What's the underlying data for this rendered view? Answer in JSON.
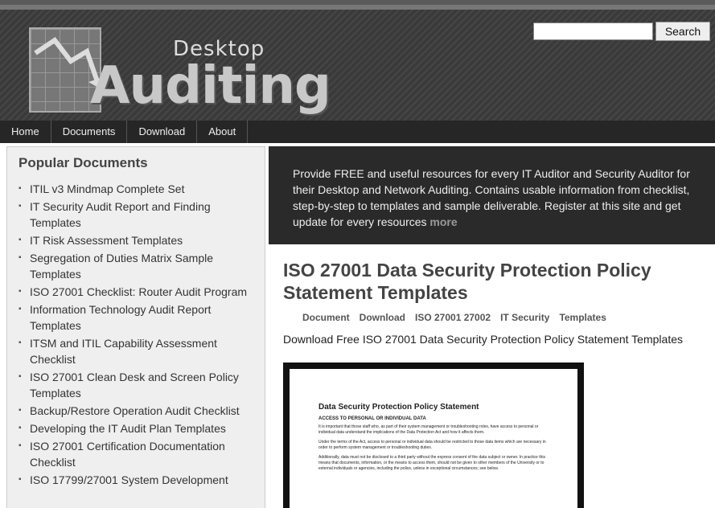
{
  "header": {
    "logo_small": "Desktop",
    "logo_large": "Auditing",
    "search": {
      "placeholder": "",
      "button_label": "Search"
    }
  },
  "nav": [
    "Home",
    "Documents",
    "Download",
    "About"
  ],
  "sidebar": {
    "title": "Popular Documents",
    "items": [
      "ITIL v3 Mindmap Complete Set",
      "IT Security Audit Report and Finding Templates",
      "IT Risk Assessment Templates",
      "Segregation of Duties Matrix Sample Templates",
      "ISO 27001 Checklist: Router Audit Program",
      "Information Technology Audit Report Templates",
      "ITSM and ITIL Capability Assessment Checklist",
      "ISO 27001 Clean Desk and Screen Policy Templates",
      "Backup/Restore Operation Audit Checklist",
      "Developing the IT Audit Plan Templates",
      "ISO 27001 Certification Documentation Checklist",
      "ISO 17799/27001 System Development"
    ]
  },
  "banner": {
    "text": "Provide FREE and useful resources for every IT Auditor and Security Auditor for their Desktop and Network Auditing. Contains usable information from checklist, step-by-step to templates and sample deliverable. Register at this site and get update for every resources",
    "more": "more"
  },
  "article": {
    "title": "ISO 27001 Data Security Protection Policy Statement Templates",
    "tags": [
      "Document",
      "Download",
      "ISO 27001 27002",
      "IT Security",
      "Templates"
    ],
    "description": "Download Free ISO 27001 Data Security Protection Policy Statement Templates"
  },
  "preview": {
    "heading": "Data Security Protection Policy Statement",
    "subheading": "ACCESS TO PERSONAL OR INDIVIDUAL DATA",
    "paragraphs": [
      "It is important that those staff who, as part of their system management or troubleshooting roles, have access to personal or individual data understand the implications of the Data Protection Act and how it affects them.",
      "Under the terms of the Act, access to personal or individual data should be restricted to those data items which are necessary in order to perform system management or troubleshooting duties.",
      "Additionally, data must not be disclosed to a third party without the express consent of the data subject or owner. In practice this means that documents, information, or the means to access them, should not be given to other members of the University or to external individuals or agencies, including the police, unless in exceptional circumstances; see below."
    ]
  }
}
